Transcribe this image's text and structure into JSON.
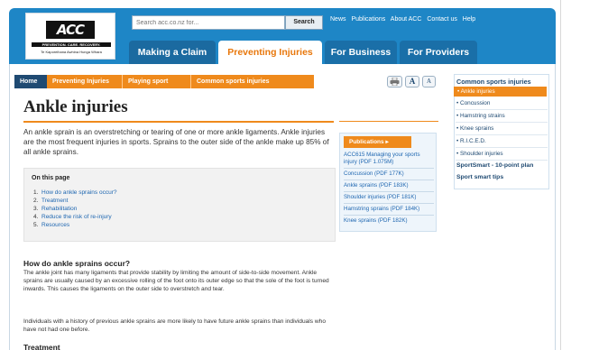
{
  "header": {
    "logo_text": "ACC",
    "logo_line1": "PREVENTION. CARE. RECOVERY.",
    "logo_line2": "Te Kaporeihana Awhina Hunga Whara",
    "search_placeholder": "Search acc.co.nz for...",
    "search_button": "Search",
    "top_links": [
      "News",
      "Publications",
      "About ACC",
      "Contact us",
      "Help"
    ],
    "tabs": [
      {
        "label": "Making a Claim",
        "active": false
      },
      {
        "label": "Preventing Injuries",
        "active": true
      },
      {
        "label": "For Business",
        "active": false
      },
      {
        "label": "For Providers",
        "active": false
      }
    ]
  },
  "breadcrumb": [
    "Home",
    "Preventing Injuries",
    "Playing sport",
    "Common sports injuries"
  ],
  "tools": {
    "print_icon": "printer-icon",
    "text_large": "A",
    "text_small": "A"
  },
  "main": {
    "title": "Ankle injuries",
    "intro": "An ankle sprain is an overstretching or tearing of one or more ankle ligaments. Ankle injuries are the most frequent injuries in sports. Sprains to the outer side of the ankle make up 85% of all ankle sprains.",
    "toc_title": "On this page",
    "toc": [
      {
        "num": "1.",
        "label": "How do ankle sprains occur?"
      },
      {
        "num": "2.",
        "label": "Treatment"
      },
      {
        "num": "3.",
        "label": "Rehabilitation"
      },
      {
        "num": "4.",
        "label": "Reduce the risk of re-injury"
      },
      {
        "num": "5.",
        "label": "Resources"
      }
    ],
    "section1_heading": "How do ankle sprains occur?",
    "section1_p1": "The ankle joint has many ligaments that provide stability by limiting the amount of side-to-side movement. Ankle sprains are usually caused by an excessive rolling of the foot onto its outer edge so that the sole of the foot is turned inwards. This causes the ligaments on the outer side to overstretch and tear.",
    "section1_p2": "Individuals with a history of previous ankle sprains are more likely to have future ankle sprains than individuals who have not had one before.",
    "section2_heading": "Treatment"
  },
  "publications": {
    "header": "Publications ▸",
    "items": [
      "ACC615 Managing your sports injury (PDF 1.075M)",
      "Concussion (PDF 177K)",
      "Ankle sprains (PDF 183K)",
      "Shoulder injuries (PDF 181K)",
      "Hamstring sprains (PDF 184K)",
      "Knee sprains (PDF 182K)"
    ]
  },
  "right_nav": {
    "title": "Common sports injuries",
    "active_item": "• Ankle injuries",
    "items": [
      "• Concussion",
      "• Hamstring strains",
      "• Knee sprains",
      "• R.I.C.E.D.",
      "• Shoulder injuries"
    ],
    "strong_items": [
      "SportSmart - 10-point plan",
      "Sport smart tips"
    ]
  },
  "colors": {
    "brand_blue": "#1e86c6",
    "accent_orange": "#ef8a1c",
    "navy": "#1f4a72",
    "link_blue": "#1f67b1"
  }
}
